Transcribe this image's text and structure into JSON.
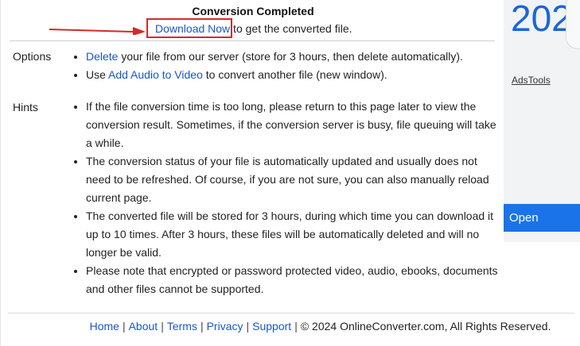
{
  "status": {
    "title": "Conversion Completed",
    "download_link": "Download Now",
    "download_suffix": " to get the converted file."
  },
  "options": {
    "label": "Options",
    "items": [
      {
        "link": "Delete",
        "text": " your file from our server (store for 3 hours, then delete automatically)."
      },
      {
        "prefix": "Use ",
        "link": "Add Audio to Video",
        "text": " to convert another file (new window)."
      }
    ]
  },
  "hints": {
    "label": "Hints",
    "items": [
      "If the file conversion time is too long, please return to this page later to view the conversion result. Sometimes, if the conversion server is busy, file queuing will take a while.",
      "The conversion status of your file is automatically updated and usually does not need to be refreshed. Of course, if you are not sure, you can also manually reload current page.",
      "The converted file will be stored for 3 hours, during which time you can download it up to 10 times. After 3 hours, these files will be automatically deleted and will no longer be valid.",
      "Please note that encrypted or password protected video, audio, ebooks, documents and other files cannot be supported."
    ]
  },
  "footer": {
    "links": [
      "Home",
      "About",
      "Terms",
      "Privacy",
      "Support"
    ],
    "separator": "|",
    "copyright": "© 2024 OnlineConverter.com, All Rights Reserved."
  },
  "ad": {
    "year_text": "202",
    "brand": "AdsTools",
    "open_button": "Open"
  },
  "colors": {
    "link": "#1a55cc",
    "highlight_box": "#d32a2a",
    "ad_button": "#1a73e8"
  }
}
